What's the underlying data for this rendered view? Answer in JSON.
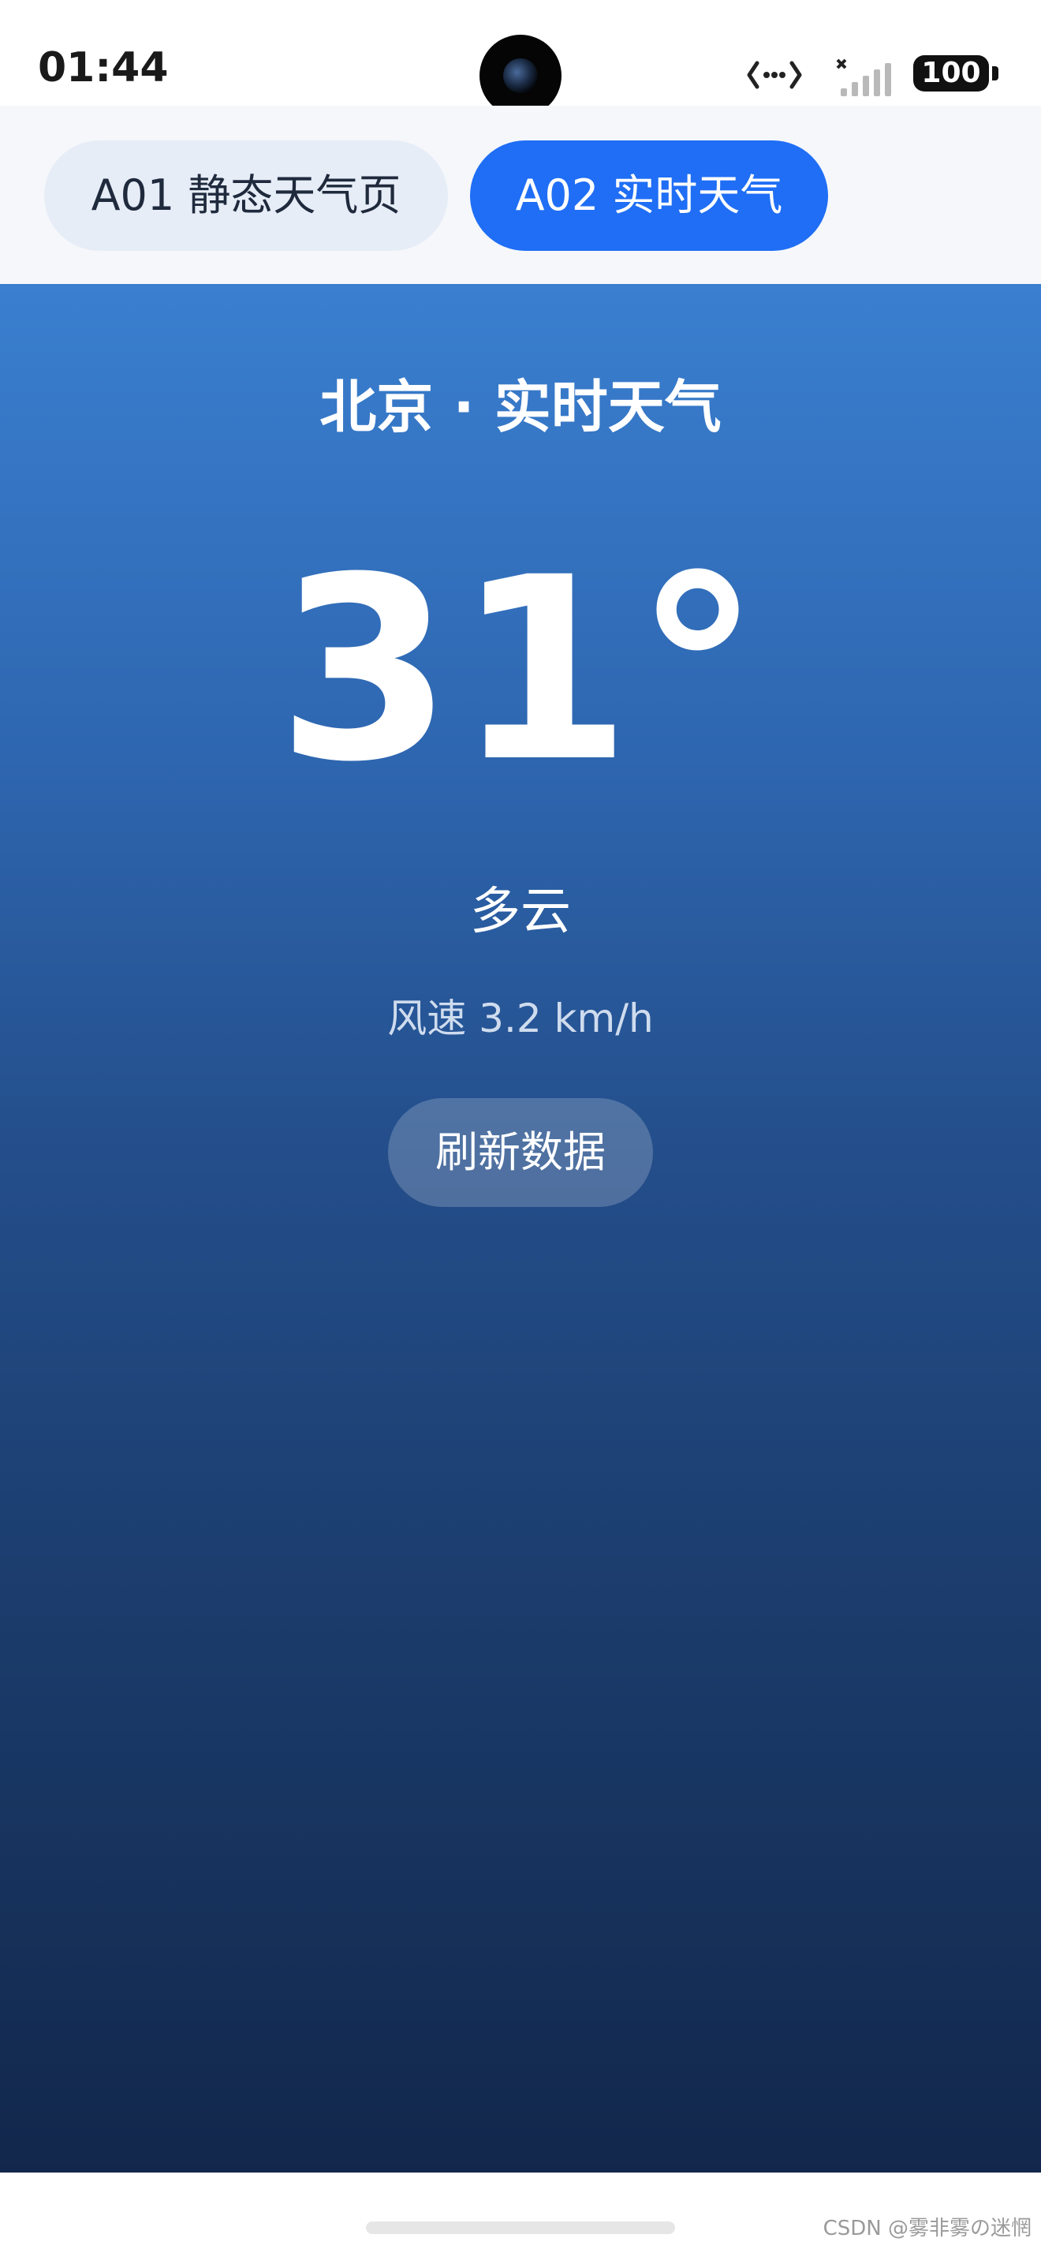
{
  "status_bar": {
    "time": "01:44",
    "battery": "100",
    "icons": [
      "camera-icon",
      "link-icon",
      "signal-icon",
      "battery-icon"
    ]
  },
  "tabs": [
    {
      "label": "A01 静态天气页",
      "selected": false
    },
    {
      "label": "A02 实时天气",
      "selected": true
    }
  ],
  "weather": {
    "title": "北京 · 实时天气",
    "temperature": "31°",
    "condition": "多云",
    "wind": "风速 3.2 km/h",
    "refresh_label": "刷新数据"
  },
  "watermark": "CSDN @雾非雾の迷惘",
  "colors": {
    "accent": "#1f6ef5",
    "panel_top": "#3a7fd0",
    "panel_bottom": "#12274b"
  }
}
